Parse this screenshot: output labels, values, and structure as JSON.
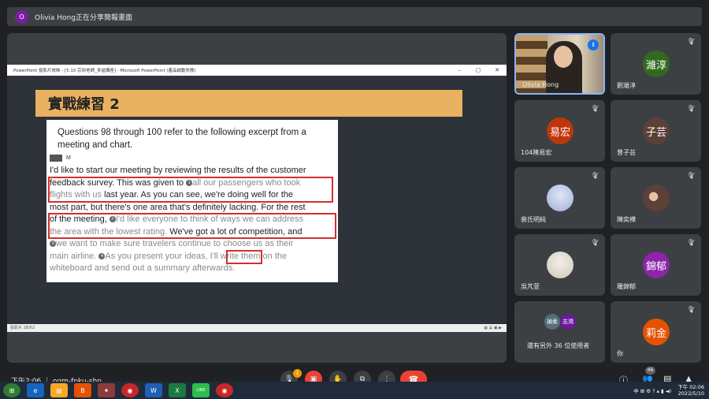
{
  "banner": {
    "avatar": "O",
    "text": "Olivia Hong正在分享簡報畫面"
  },
  "ppt": {
    "titlebar": "PowerPoint 投影片放映 - [5.10 宗欣老師_多益講座] - Microsoft PowerPoint (產品啟動失敗)",
    "slide_title": "實戰練習 2",
    "question": "Questions 98 through 100 refer to the following excerpt from a meeting and chart.",
    "speaker": "M",
    "status_left": "投影片 28/62",
    "ctrl": [
      "–",
      "▢",
      "✕"
    ]
  },
  "excerpt_lines": {
    "l1": "I'd like to start our meeting by reviewing the results of the customer",
    "l2a": "feedback survey. This was given to ",
    "n1": "1",
    "l2b": "all our passengers who took",
    "l3a": "flights with us",
    "l3b": " last year. As you can see, we're doing well for the",
    "l4": "most part, but there's one area that's definitely lacking. For the rest",
    "l5a": "of the meeting, ",
    "n2": "2",
    "l5b": "I'd like everyone to think of ways we can address",
    "l6a": "the area with the lowest rating.",
    "l6b": " We've got a lot of competition, and",
    "n3": "3",
    "l7": "we want to make sure travelers continue to choose us as their",
    "l8a": "main airline. ",
    "n4": "4",
    "l8b": "As you present your ideas, ",
    "l8c": "I'll write",
    "l8d": " them on the",
    "l9": "whiteboard and send out a summary afterwards."
  },
  "tiles": [
    {
      "name": "Olivia Hong",
      "type": "video"
    },
    {
      "name": "劉濰淳",
      "initials": "濰淳",
      "color": "#33691e"
    },
    {
      "name": "104陳易宏",
      "initials": "易宏",
      "color": "#bf360c"
    },
    {
      "name": "曾子芸",
      "initials": "子芸",
      "color": "#5d4037"
    },
    {
      "name": "裴氏明純",
      "type": "photo",
      "color": "#c5cae9"
    },
    {
      "name": "陳奕樺",
      "type": "photo",
      "color": "#5d4037"
    },
    {
      "name": "吳芃萱",
      "type": "photo",
      "color": "#e0ddd5"
    },
    {
      "name": "羅錦郁",
      "initials": "錦郁",
      "color": "#8e24aa"
    },
    {
      "name": "還有另外 36 位使用者",
      "initials_a": "禎柔",
      "initials_b": "志鴻"
    },
    {
      "name": "你",
      "initials": "莉金",
      "color": "#e65100"
    }
  ],
  "bottom": {
    "clock": "下午2:06 ｜ ogm-fpku-shn",
    "badge": "1",
    "participants": "46"
  },
  "taskbar": {
    "apps": [
      "⊞",
      "e",
      "▤",
      "B",
      "✦",
      "◉",
      "W",
      "X",
      "LINE",
      "◉"
    ],
    "tray": "中 ⊞ ⚙ ? ▴ ▮ ◄)",
    "time1": "下午 02:06",
    "time2": "2022/5/10"
  },
  "colors": {
    "accent": "#1a73e8",
    "danger": "#ea4335",
    "slide_title_bg": "#e8b260"
  }
}
